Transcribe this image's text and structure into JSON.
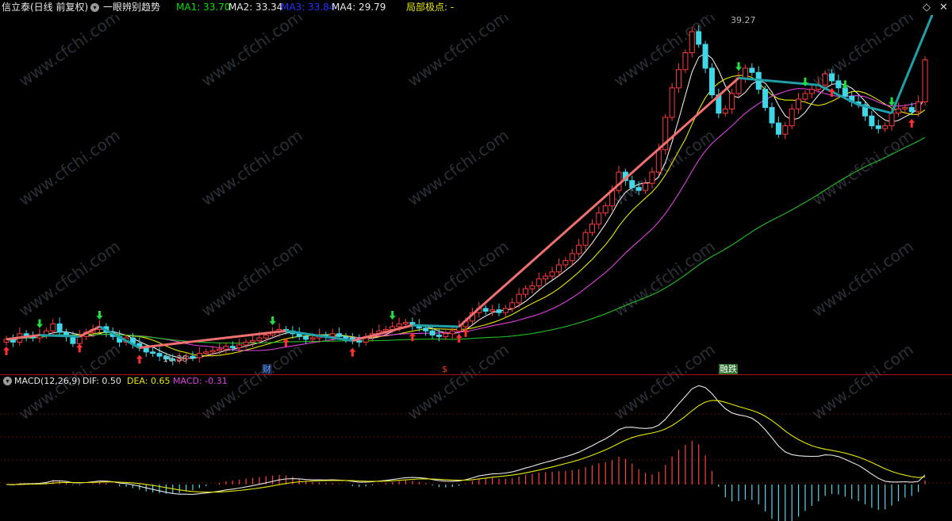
{
  "header": {
    "stock_title": "信立泰(日线 前复权)",
    "indicator_name": "一眼辨别趋势",
    "ma": [
      {
        "label": "MA1: 33.70",
        "color": "#00e000"
      },
      {
        "label": "MA2: 33.34",
        "color": "#e8e8e8"
      },
      {
        "label": "MA3: 33.84",
        "color": "#2233ff"
      },
      {
        "label": "MA4: 29.79",
        "color": "#e8e8e8"
      }
    ],
    "local_extreme_label": "局部极点: -",
    "local_extreme_color": "#e8e800",
    "right_icon": "diamond-icon"
  },
  "price_chart": {
    "high_label": "39.27",
    "low_label": "16.38",
    "events": [
      {
        "label": "财",
        "color": "#5aa0ff",
        "bg": "#1a2440"
      },
      {
        "label": "$",
        "color": "#ff3030",
        "bg": "transparent"
      },
      {
        "label": "融跌",
        "color": "#ffffff",
        "bg": "#2a6a2a"
      }
    ]
  },
  "macd_panel": {
    "title": "MACD(12,26,9)",
    "dif": "DIF: 0.50",
    "dea": "DEA: 0.65",
    "macd": "MACD: -0.31",
    "dif_color": "#e8e8e8",
    "dea_color": "#e8e800",
    "macd_color": "#e040e0"
  },
  "watermark": "www.cfchi.com",
  "chart_data": {
    "type": "candlestick",
    "note_series": [
      "close",
      "MA5",
      "MA10",
      "MA20",
      "MA60",
      "trend_zigzag",
      "MACD"
    ],
    "close": [
      16.7,
      16.5,
      17.1,
      16.9,
      16.8,
      17.0,
      17.3,
      17.8,
      17.2,
      16.9,
      16.4,
      16.9,
      17.2,
      17.4,
      17.6,
      17.2,
      16.9,
      16.5,
      16.8,
      16.4,
      16.1,
      15.8,
      15.7,
      15.5,
      15.3,
      15.2,
      15.3,
      15.5,
      15.4,
      15.7,
      15.8,
      15.9,
      16.0,
      16.2,
      16.1,
      16.3,
      16.5,
      16.6,
      16.8,
      17.0,
      17.2,
      17.4,
      17.3,
      17.1,
      16.9,
      16.7,
      16.8,
      17.0,
      16.9,
      17.1,
      16.9,
      16.8,
      16.6,
      16.5,
      16.9,
      17.1,
      17.3,
      17.4,
      17.6,
      17.8,
      17.9,
      17.7,
      17.5,
      17.3,
      17.0,
      16.9,
      17.1,
      17.3,
      17.6,
      18.0,
      18.6,
      18.9,
      18.7,
      18.8,
      18.6,
      18.9,
      19.3,
      19.9,
      20.3,
      20.5,
      21.0,
      21.2,
      21.5,
      22.0,
      22.3,
      22.8,
      23.4,
      24.3,
      24.9,
      25.7,
      26.2,
      27.3,
      28.6,
      28.0,
      27.5,
      27.3,
      27.8,
      28.6,
      30.2,
      32.5,
      34.6,
      35.9,
      37.1,
      38.6,
      37.7,
      36.0,
      34.1,
      32.8,
      33.1,
      34.2,
      35.3,
      36.0,
      35.7,
      34.5,
      33.2,
      32.1,
      31.3,
      31.9,
      33.1,
      33.8,
      34.2,
      34.5,
      34.8,
      35.6,
      35.1,
      34.6,
      34.0,
      33.6,
      33.4,
      32.6,
      31.9,
      31.7,
      31.9,
      32.8,
      33.1,
      33.2,
      32.9,
      33.6,
      36.6
    ],
    "y_range": [
      15.0,
      39.5
    ],
    "macd_range": [
      -1.45,
      4.0
    ],
    "dif_last": 0.5,
    "dea_last": 0.65,
    "macd_last": -0.31
  }
}
